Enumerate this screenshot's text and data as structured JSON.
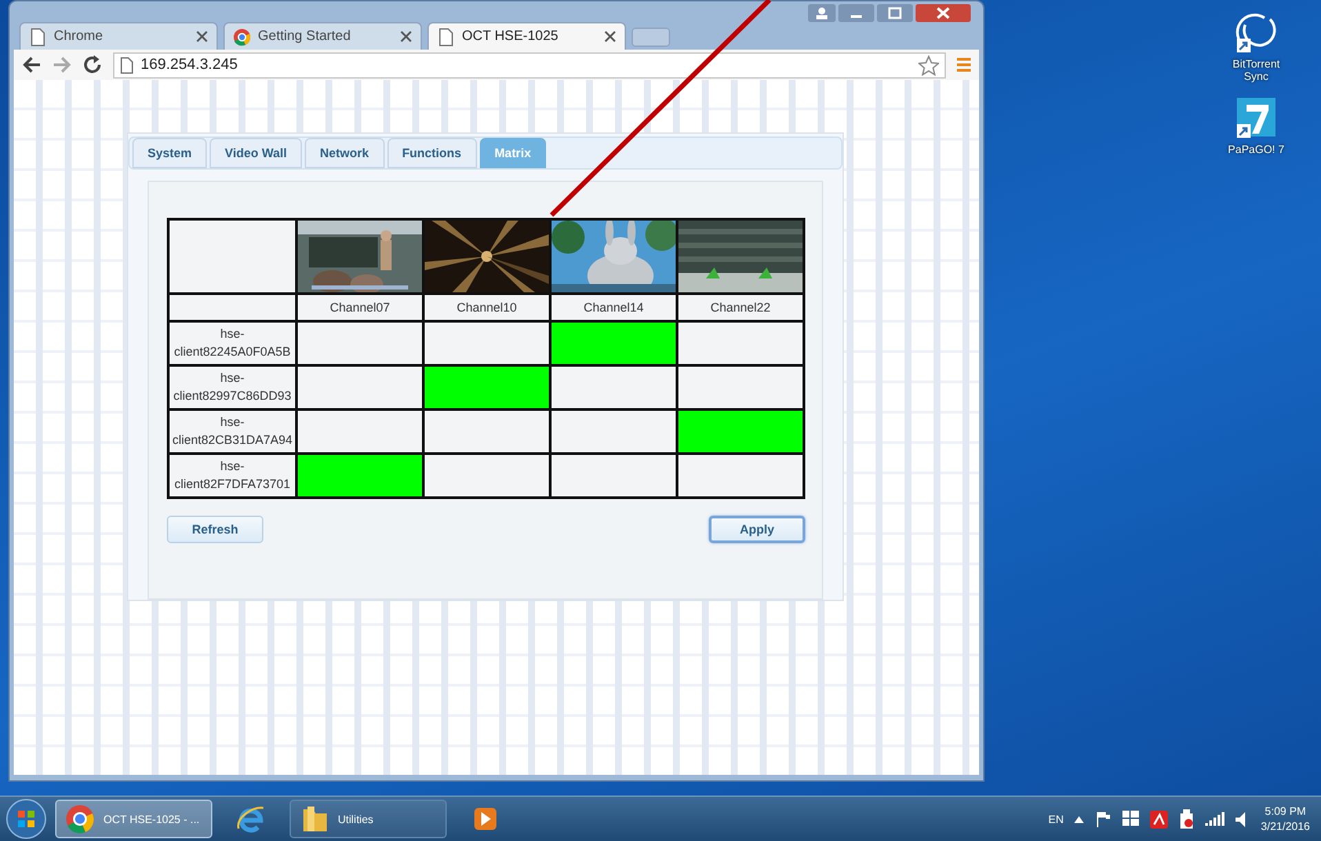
{
  "browser": {
    "tabs": [
      {
        "title": "Chrome",
        "selected": false
      },
      {
        "title": "Getting Started",
        "selected": false
      },
      {
        "title": "OCT HSE-1025",
        "selected": true
      }
    ],
    "url": "169.254.3.245"
  },
  "page": {
    "tabs": [
      {
        "label": "System",
        "selected": false
      },
      {
        "label": "Video Wall",
        "selected": false
      },
      {
        "label": "Network",
        "selected": false
      },
      {
        "label": "Functions",
        "selected": false
      },
      {
        "label": "Matrix",
        "selected": true
      }
    ],
    "matrix": {
      "channels": [
        {
          "name": "Channel07"
        },
        {
          "name": "Channel10"
        },
        {
          "name": "Channel14"
        },
        {
          "name": "Channel22"
        }
      ],
      "clients": [
        {
          "name": "hse-\nclient82245A0F0A5B",
          "routes": [
            false,
            false,
            true,
            false
          ]
        },
        {
          "name": "hse-\nclient82997C86DD93",
          "routes": [
            false,
            true,
            false,
            false
          ]
        },
        {
          "name": "hse-\nclient82CB31DA7A94",
          "routes": [
            false,
            false,
            false,
            true
          ]
        },
        {
          "name": "hse-\nclient82F7DFA73701",
          "routes": [
            true,
            false,
            false,
            false
          ]
        }
      ]
    },
    "buttons": [
      {
        "label": "Refresh",
        "focused": false
      },
      {
        "label": "Apply",
        "focused": true
      }
    ]
  },
  "desktop_icons": [
    {
      "label": "BitTorrent\nSync",
      "kind": "sync"
    },
    {
      "label": "PaPaGO! 7",
      "kind": "seven"
    }
  ],
  "taskbar": {
    "items": [
      {
        "label": "OCT HSE-1025 - ...",
        "kind": "chrome",
        "selected": true
      },
      {
        "kind": "ie",
        "selected": false
      },
      {
        "label": "Utilities",
        "kind": "folder",
        "selected": false
      },
      {
        "kind": "media",
        "selected": false
      }
    ],
    "language": "EN",
    "time": "5:09 PM",
    "date": "3/21/2016"
  }
}
